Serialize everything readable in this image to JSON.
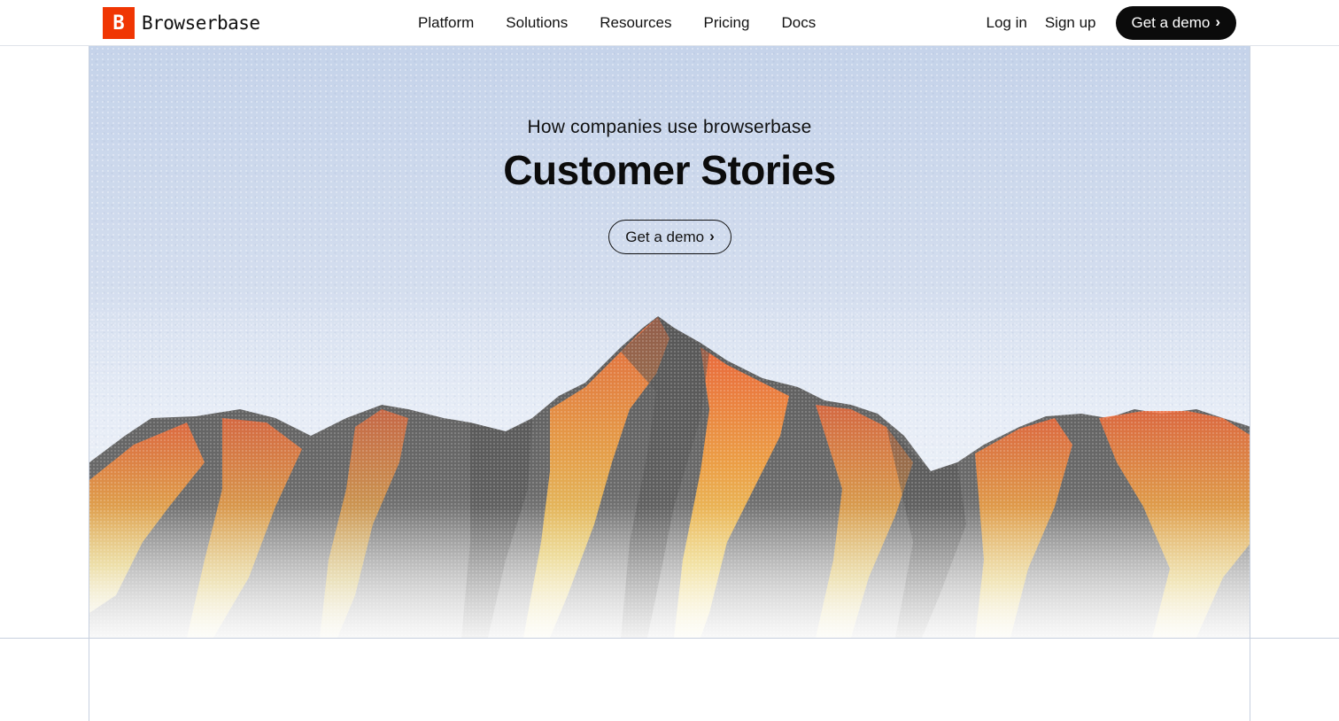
{
  "brand": {
    "name": "Browserbase",
    "mark_letter": "B",
    "accent_color": "#f03603"
  },
  "nav": {
    "items": [
      {
        "label": "Platform"
      },
      {
        "label": "Solutions"
      },
      {
        "label": "Resources"
      },
      {
        "label": "Pricing"
      },
      {
        "label": "Docs"
      }
    ]
  },
  "auth": {
    "login_label": "Log in",
    "signup_label": "Sign up",
    "demo_label": "Get a demo",
    "demo_icon": "chevron-right-icon"
  },
  "hero": {
    "eyebrow": "How companies use browserbase",
    "title": "Customer Stories",
    "cta_label": "Get a demo",
    "cta_icon": "chevron-right-icon",
    "image": "mountain-illustration",
    "sky_color": "#c5d3ea"
  }
}
